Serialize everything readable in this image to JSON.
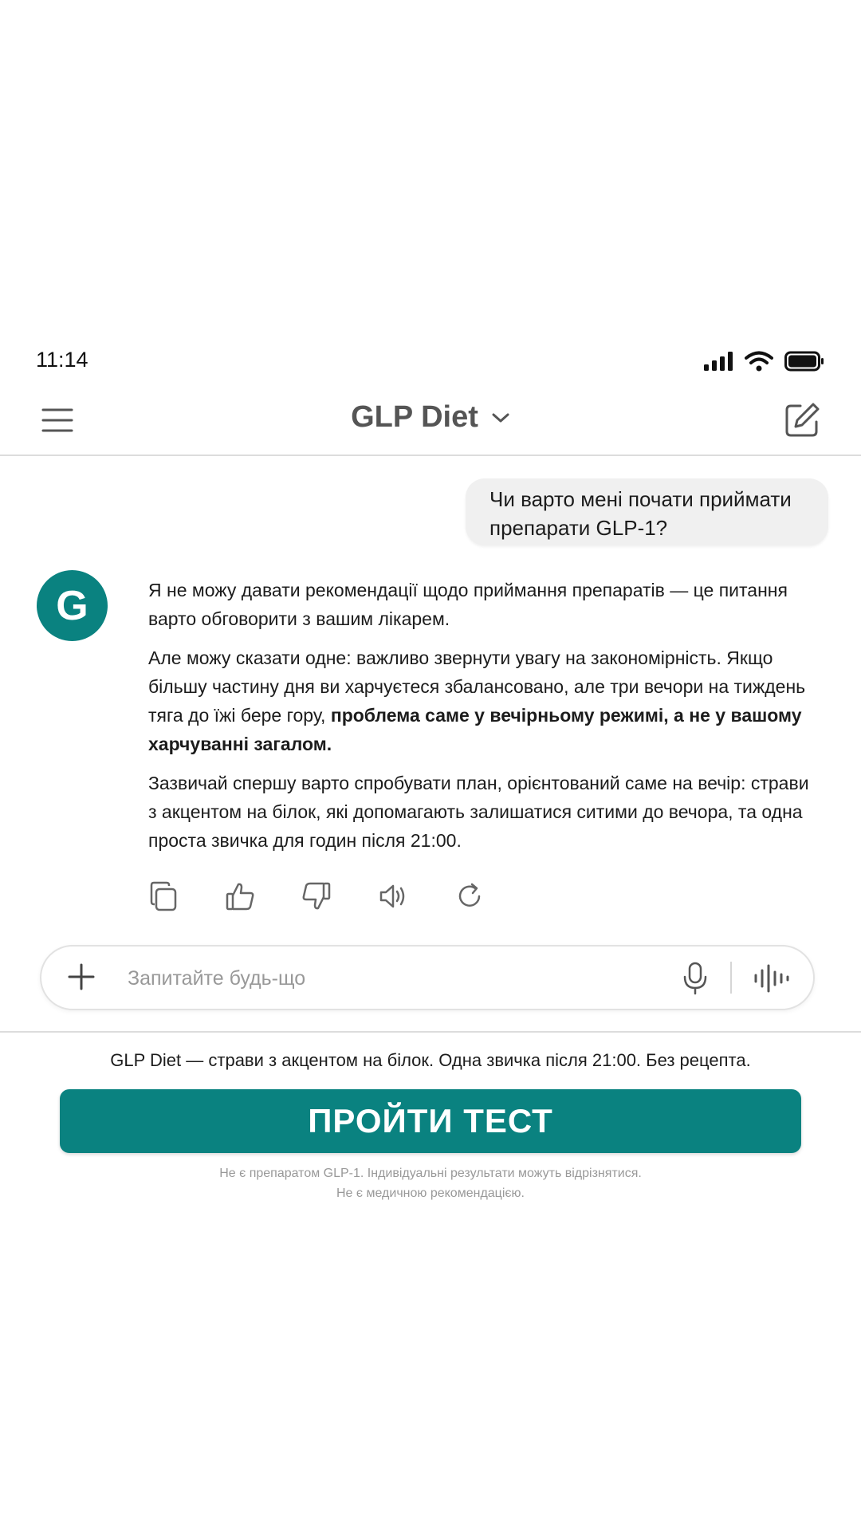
{
  "status_bar": {
    "time": "11:14"
  },
  "header": {
    "title": "GLP Diet"
  },
  "chat": {
    "user_message": "Чи варто мені почати приймати препарати GLP-1?",
    "assistant_avatar_letter": "G",
    "assistant_paragraphs": {
      "p1": "Я не можу давати рекомендації щодо приймання препаратів — це питання варто обговорити з вашим лікарем.",
      "p2_text": "Але можу сказати одне: важливо звернути увагу на закономірність. Якщо більшу частину дня ви харчуєтеся збалансовано, але три вечори на тиждень тяга до їжі бере гору, ",
      "p2_bold": "проблема саме у вечірньому режимі, а не у вашому харчуванні загалом.",
      "p3": "Зазвичай спершу варто спробувати план, орієнтований саме на вечір: страви з акцентом на білок, які допомагають залишатися ситими до вечора, та одна проста звичка для годин після 21:00."
    }
  },
  "composer": {
    "placeholder": "Запитайте будь-що"
  },
  "promo": {
    "tagline": "GLP Diet — страви з акцентом на білок. Одна звичка після 21:00. Без рецепта.",
    "cta_label": "ПРОЙТИ ТЕСТ",
    "disclaimer_line1": "Не є препаратом GLP-1. Індивідуальні результати можуть відрізнятися.",
    "disclaimer_line2": "Не є медичною рекомендацією."
  },
  "colors": {
    "accent": "#0a8280",
    "bubble": "#f0f0f0",
    "muted": "#999999"
  },
  "icons": [
    "signal-icon",
    "wifi-icon",
    "battery-icon",
    "hamburger-icon",
    "chevron-down-icon",
    "edit-icon",
    "copy-icon",
    "thumbs-up-icon",
    "thumbs-down-icon",
    "speaker-icon",
    "refresh-icon",
    "plus-icon",
    "mic-icon",
    "voice-waveform-icon"
  ]
}
